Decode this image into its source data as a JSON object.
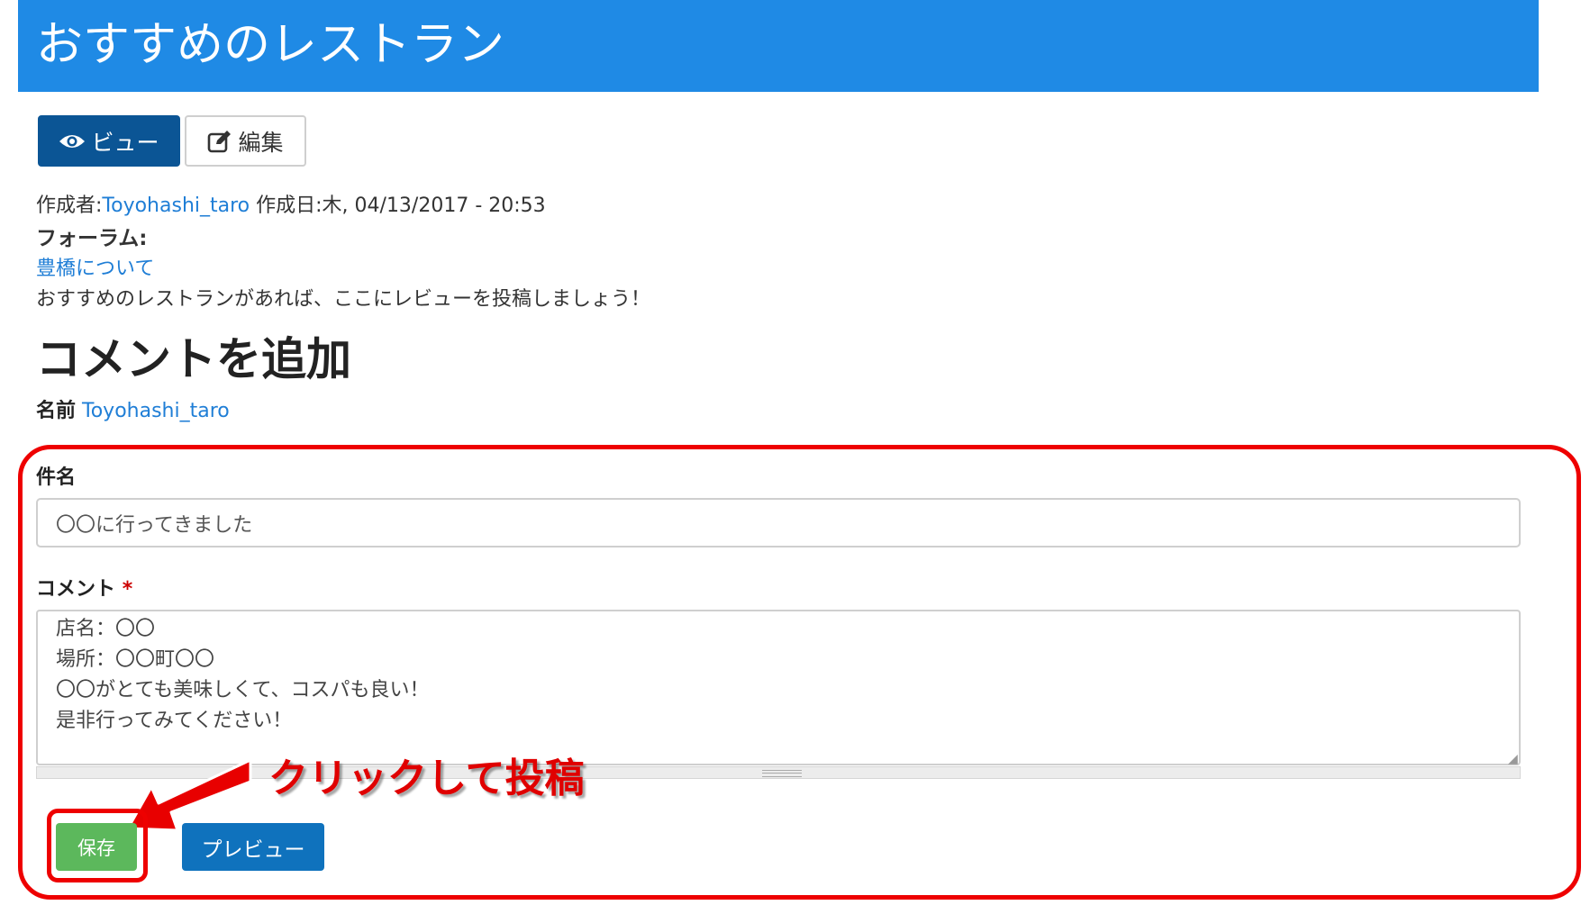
{
  "header": {
    "title": "おすすめのレストラン"
  },
  "tabs": [
    {
      "label": "ビュー",
      "icon": "eye-icon",
      "active": true
    },
    {
      "label": "編集",
      "icon": "edit-icon",
      "active": false
    }
  ],
  "meta": {
    "author_label": "作成者:",
    "author": "Toyohashi_taro",
    "date_label": " 作成日:",
    "date": "木, 04/13/2017 - 20:53"
  },
  "forum": {
    "label": "フォーラム:",
    "link": "豊橋について"
  },
  "intro": "おすすめのレストランがあれば、ここにレビューを投稿しましょう！",
  "comment_form": {
    "heading": "コメントを追加",
    "name_label": "名前",
    "name_value": "Toyohashi_taro",
    "subject_label": "件名",
    "subject_value": "〇〇に行ってきました",
    "comment_label": "コメント",
    "required_mark": "*",
    "comment_value": "店名：〇〇\n場所：〇〇町〇〇\n〇〇がとても美味しくて、コスパも良い！\n是非行ってみてください！",
    "save_label": "保存",
    "preview_label": "プレビュー"
  },
  "annotation": {
    "text": "クリックして投稿"
  },
  "colors": {
    "header": "#1f8ae5",
    "tab_active": "#0b5595",
    "link": "#1f7ed6",
    "save": "#5cb85c",
    "preview": "#0f72bd",
    "annotation": "#ee0000"
  }
}
